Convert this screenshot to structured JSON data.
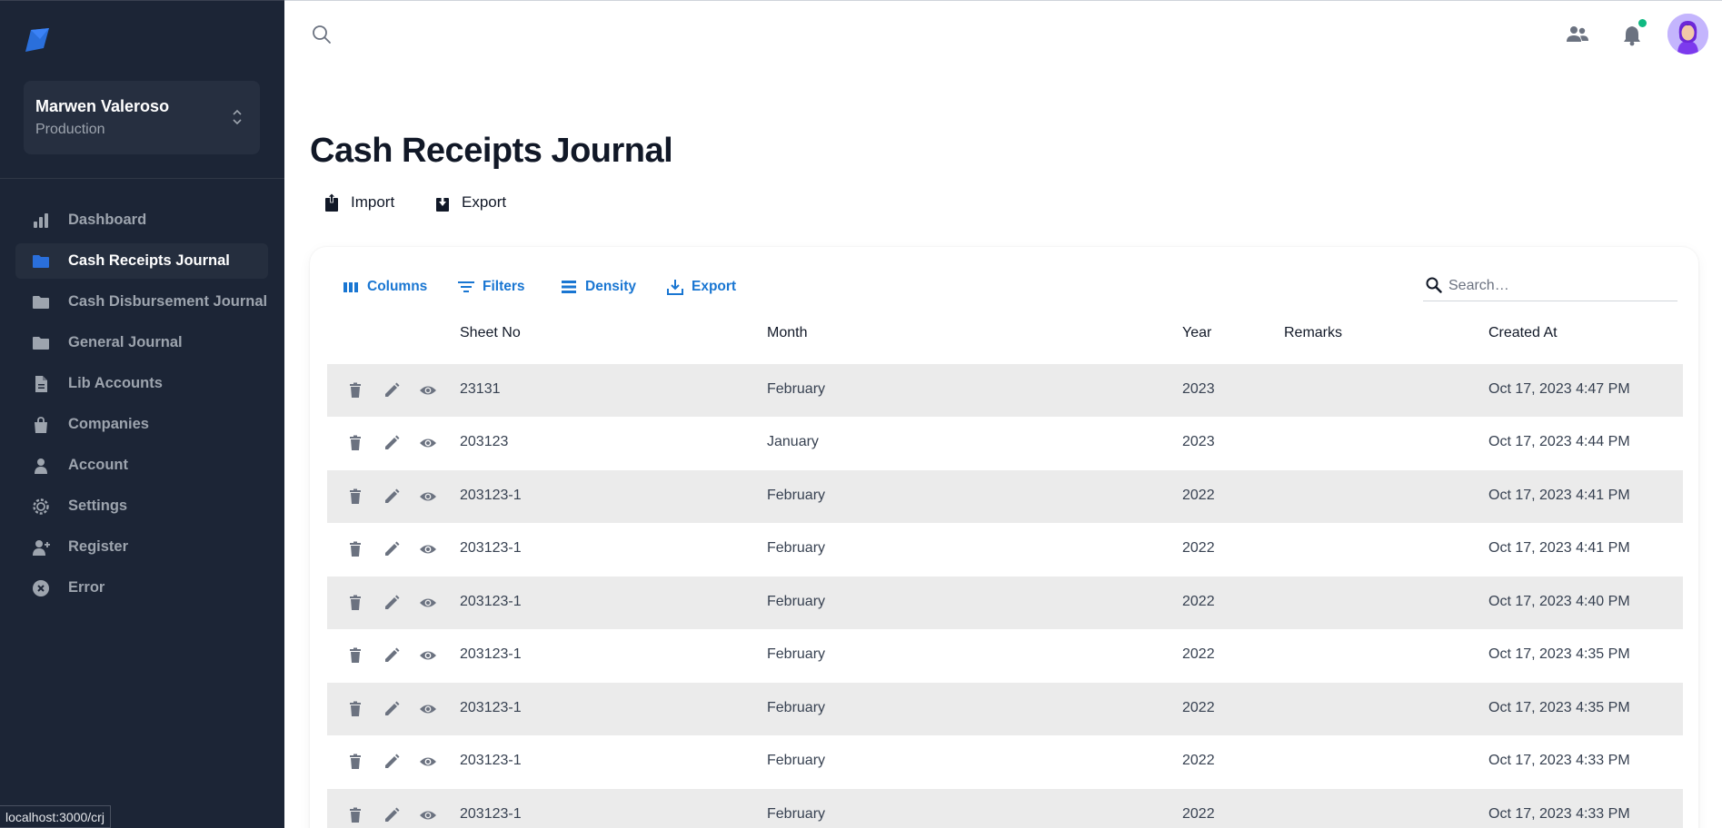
{
  "colors": {
    "sidebar_bg": "#1c2536",
    "accent": "#1976d2",
    "logo": "#2a6fdb",
    "row_shade": "#ebebeb",
    "notification_dot": "#10b981"
  },
  "sidebar": {
    "org": {
      "name": "Marwen Valeroso",
      "environment": "Production"
    },
    "items": [
      {
        "label": "Dashboard",
        "icon": "bar-chart-icon",
        "active": false
      },
      {
        "label": "Cash Receipts Journal",
        "icon": "folder-icon",
        "active": true
      },
      {
        "label": "Cash Disbursement Journal",
        "icon": "folder-icon",
        "active": false
      },
      {
        "label": "General Journal",
        "icon": "folder-icon",
        "active": false
      },
      {
        "label": "Lib Accounts",
        "icon": "document-icon",
        "active": false
      },
      {
        "label": "Companies",
        "icon": "shopping-bag-icon",
        "active": false
      },
      {
        "label": "Account",
        "icon": "user-icon",
        "active": false
      },
      {
        "label": "Settings",
        "icon": "gear-icon",
        "active": false
      },
      {
        "label": "Register",
        "icon": "user-plus-icon",
        "active": false
      },
      {
        "label": "Error",
        "icon": "x-circle-icon",
        "active": false
      }
    ]
  },
  "status_bar": {
    "url": "localhost:3000/crj"
  },
  "header": {
    "icons": [
      "search-icon",
      "people-icon",
      "bell-icon",
      "avatar"
    ]
  },
  "page": {
    "title": "Cash Receipts Journal",
    "actions": {
      "import": "Import",
      "export": "Export"
    }
  },
  "grid": {
    "toolbar": {
      "columns": "Columns",
      "filters": "Filters",
      "density": "Density",
      "export": "Export"
    },
    "search": {
      "placeholder": "Search…"
    },
    "columns": {
      "sheet_no": "Sheet No",
      "month": "Month",
      "year": "Year",
      "remarks": "Remarks",
      "created_at": "Created At"
    },
    "rows": [
      {
        "sheet_no": "23131",
        "month": "February",
        "year": "2023",
        "remarks": "",
        "created_at": "Oct 17, 2023 4:47 PM"
      },
      {
        "sheet_no": "203123",
        "month": "January",
        "year": "2023",
        "remarks": "",
        "created_at": "Oct 17, 2023 4:44 PM"
      },
      {
        "sheet_no": "203123-1",
        "month": "February",
        "year": "2022",
        "remarks": "",
        "created_at": "Oct 17, 2023 4:41 PM"
      },
      {
        "sheet_no": "203123-1",
        "month": "February",
        "year": "2022",
        "remarks": "",
        "created_at": "Oct 17, 2023 4:41 PM"
      },
      {
        "sheet_no": "203123-1",
        "month": "February",
        "year": "2022",
        "remarks": "",
        "created_at": "Oct 17, 2023 4:40 PM"
      },
      {
        "sheet_no": "203123-1",
        "month": "February",
        "year": "2022",
        "remarks": "",
        "created_at": "Oct 17, 2023 4:35 PM"
      },
      {
        "sheet_no": "203123-1",
        "month": "February",
        "year": "2022",
        "remarks": "",
        "created_at": "Oct 17, 2023 4:35 PM"
      },
      {
        "sheet_no": "203123-1",
        "month": "February",
        "year": "2022",
        "remarks": "",
        "created_at": "Oct 17, 2023 4:33 PM"
      },
      {
        "sheet_no": "203123-1",
        "month": "February",
        "year": "2022",
        "remarks": "",
        "created_at": "Oct 17, 2023 4:33 PM"
      }
    ]
  }
}
